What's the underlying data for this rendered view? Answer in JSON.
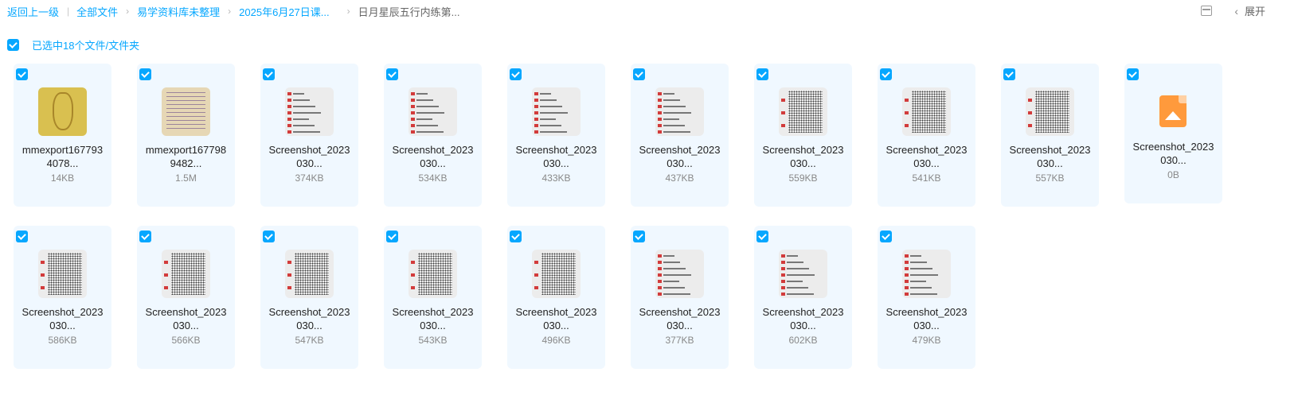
{
  "breadcrumb": {
    "back": "返回上一级",
    "items": [
      "全部文件",
      "易学资料库未整理",
      "2025年6月27日课..."
    ],
    "current": "日月星辰五行内练第..."
  },
  "toolbar": {
    "expand_label": "展开",
    "layout_icon": "list-layout-icon"
  },
  "selection": {
    "text": "已选中18个文件/文件夹"
  },
  "accent": "#06a7ff",
  "files": [
    {
      "name": "mmexport167793 4078...",
      "line1": "mmexport167793",
      "line2": "4078...",
      "size": "14KB",
      "thumb": "photo"
    },
    {
      "name": "mmexport167798 9482...",
      "line1": "mmexport167798",
      "line2": "9482...",
      "size": "1.5M",
      "thumb": "note"
    },
    {
      "line1": "Screenshot_2023",
      "line2": "030...",
      "size": "374KB",
      "thumb": "chat"
    },
    {
      "line1": "Screenshot_2023",
      "line2": "030...",
      "size": "534KB",
      "thumb": "chat"
    },
    {
      "line1": "Screenshot_2023",
      "line2": "030...",
      "size": "433KB",
      "thumb": "chat"
    },
    {
      "line1": "Screenshot_2023",
      "line2": "030...",
      "size": "437KB",
      "thumb": "chat"
    },
    {
      "line1": "Screenshot_2023",
      "line2": "030...",
      "size": "559KB",
      "thumb": "text"
    },
    {
      "line1": "Screenshot_2023",
      "line2": "030...",
      "size": "541KB",
      "thumb": "text"
    },
    {
      "line1": "Screenshot_2023",
      "line2": "030...",
      "size": "557KB",
      "thumb": "text"
    },
    {
      "line1": "Screenshot_2023",
      "line2": "030...",
      "size": "0B",
      "thumb": "icon"
    },
    {
      "line1": "Screenshot_2023",
      "line2": "030...",
      "size": "586KB",
      "thumb": "text"
    },
    {
      "line1": "Screenshot_2023",
      "line2": "030...",
      "size": "566KB",
      "thumb": "text"
    },
    {
      "line1": "Screenshot_2023",
      "line2": "030...",
      "size": "547KB",
      "thumb": "text"
    },
    {
      "line1": "Screenshot_2023",
      "line2": "030...",
      "size": "543KB",
      "thumb": "text"
    },
    {
      "line1": "Screenshot_2023",
      "line2": "030...",
      "size": "496KB",
      "thumb": "text"
    },
    {
      "line1": "Screenshot_2023",
      "line2": "030...",
      "size": "377KB",
      "thumb": "chat"
    },
    {
      "line1": "Screenshot_2023",
      "line2": "030...",
      "size": "602KB",
      "thumb": "chat"
    },
    {
      "line1": "Screenshot_2023",
      "line2": "030...",
      "size": "479KB",
      "thumb": "chat"
    }
  ]
}
